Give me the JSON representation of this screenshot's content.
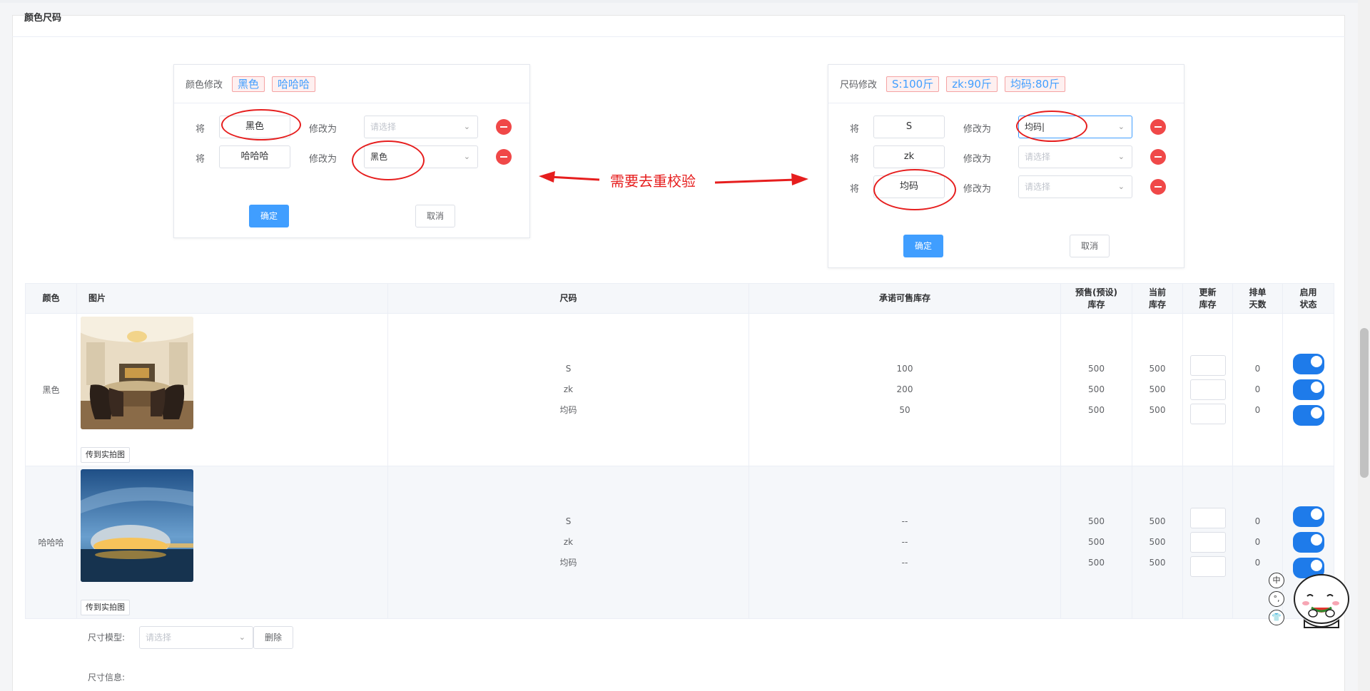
{
  "card": {
    "title": "颜色尺码"
  },
  "color_panel": {
    "title": "颜色修改",
    "tags": [
      "黑色",
      "哈哈哈"
    ],
    "rows": [
      {
        "label": "将",
        "source": "黑色",
        "to_label": "修改为",
        "target": "",
        "placeholder": "请选择"
      },
      {
        "label": "将",
        "source": "哈哈哈",
        "to_label": "修改为",
        "target": "黑色",
        "placeholder": "请选择"
      }
    ],
    "confirm": "确定",
    "cancel": "取消"
  },
  "size_panel": {
    "title": "尺码修改",
    "tags": [
      "S:100斤",
      "zk:90斤",
      "均码:80斤"
    ],
    "rows": [
      {
        "label": "将",
        "source": "S",
        "to_label": "修改为",
        "target": "均码|",
        "placeholder": "请选择"
      },
      {
        "label": "将",
        "source": "zk",
        "to_label": "修改为",
        "target": "",
        "placeholder": "请选择"
      },
      {
        "label": "将",
        "source": "均码",
        "to_label": "修改为",
        "target": "",
        "placeholder": "请选择"
      }
    ],
    "confirm": "确定",
    "cancel": "取消"
  },
  "annotation": "需要去重校验",
  "table": {
    "headers": {
      "color": "颜色",
      "image": "图片",
      "size": "尺码",
      "promise_stock": "承诺可售库存",
      "presale_l1": "预售(预设)",
      "presale_l2": "库存",
      "current_l1": "当前",
      "current_l2": "库存",
      "update_l1": "更新",
      "update_l2": "库存",
      "days_l1": "排单",
      "days_l2": "天数",
      "status_l1": "启用",
      "status_l2": "状态"
    },
    "upload_label": "传到实拍图",
    "rows": [
      {
        "color": "黑色",
        "sizes": [
          "S",
          "zk",
          "均码"
        ],
        "promise": [
          "100",
          "200",
          "50"
        ],
        "presale": [
          "500",
          "500",
          "500"
        ],
        "current": [
          "500",
          "500",
          "500"
        ],
        "days": [
          "0",
          "0",
          "0"
        ]
      },
      {
        "color": "哈哈哈",
        "sizes": [
          "S",
          "zk",
          "均码"
        ],
        "promise": [
          "--",
          "--",
          "--"
        ],
        "presale": [
          "500",
          "500",
          "500"
        ],
        "current": [
          "500",
          "500",
          "500"
        ],
        "days": [
          "0",
          "0",
          "0"
        ]
      }
    ]
  },
  "size_model": {
    "label": "尺寸模型:",
    "placeholder": "请选择",
    "delete": "删除"
  },
  "size_info": {
    "label": "尺寸信息:"
  },
  "float_icons": [
    "中",
    "°,",
    "👕"
  ],
  "colors": {
    "primary": "#409eff",
    "danger": "#f04848",
    "annotation": "#e61e1e",
    "switch_on": "#1e7bea"
  }
}
